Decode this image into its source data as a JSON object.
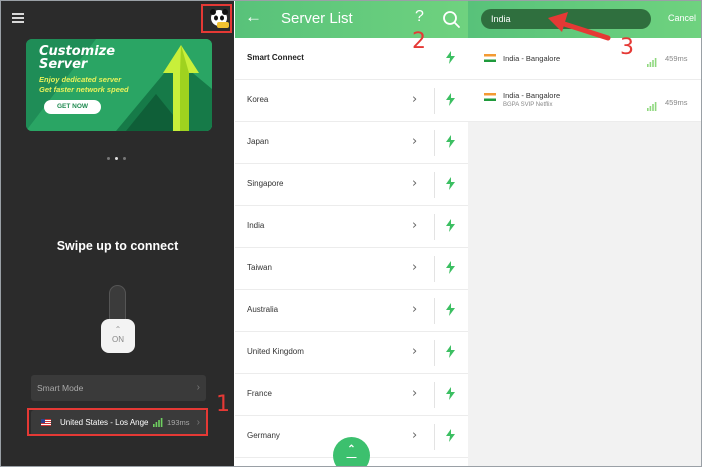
{
  "colors": {
    "accent_green": "#5cc67a",
    "annotation_red": "#e53935",
    "dark_bg": "#2b2b2b"
  },
  "home": {
    "banner": {
      "title": "Customize Server",
      "subtitle_line1": "Enjoy dedicated server",
      "subtitle_line2": "Get faster network speed",
      "cta": "GET NOW"
    },
    "carousel_total": 3,
    "carousel_active": 2,
    "swipe_text": "Swipe up to connect",
    "knob_label": "ON",
    "smart_mode": "Smart Mode",
    "location": {
      "name": "United States - Los Ange",
      "latency": "193ms"
    }
  },
  "server_list": {
    "title": "Server List",
    "items": [
      {
        "label": "Smart Connect"
      },
      {
        "label": "Korea"
      },
      {
        "label": "Japan"
      },
      {
        "label": "Singapore"
      },
      {
        "label": "India"
      },
      {
        "label": "Taiwan"
      },
      {
        "label": "Australia"
      },
      {
        "label": "United Kingdom"
      },
      {
        "label": "France"
      },
      {
        "label": "Germany"
      }
    ]
  },
  "search": {
    "query": "India",
    "cancel": "Cancel",
    "results": [
      {
        "name": "India - Bangalore",
        "sub": "",
        "latency": "459ms"
      },
      {
        "name": "India - Bangalore",
        "sub": "BGPA SVIP Netflix",
        "latency": "459ms"
      }
    ]
  },
  "annotations": {
    "step1": "1",
    "step2": "2",
    "step3": "3"
  }
}
